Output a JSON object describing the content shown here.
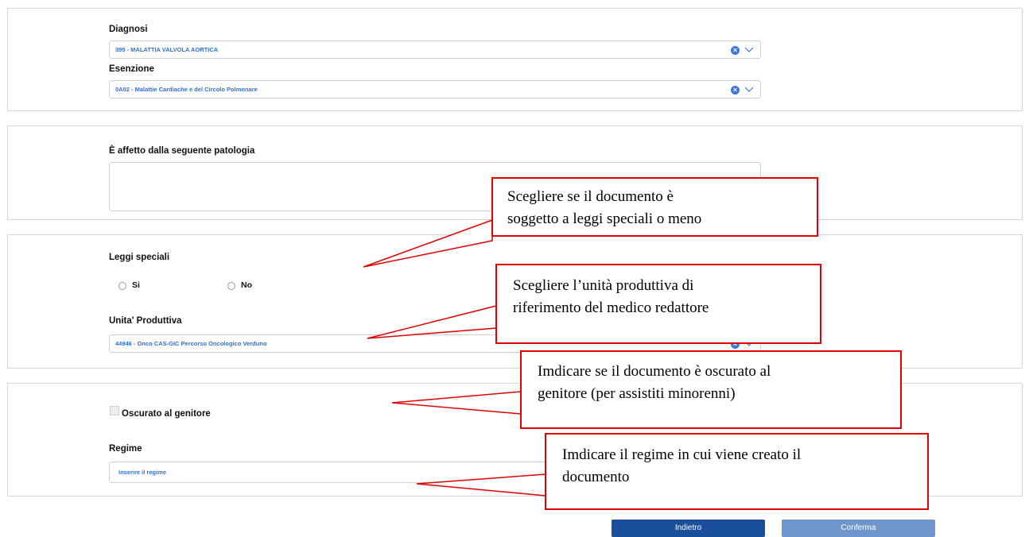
{
  "diagnosis_section": {
    "diagnosi_label": "Diagnosi",
    "diagnosi_value": "395 - MALATTIA VALVOLA AORTICA",
    "esenzione_label": "Esenzione",
    "esenzione_value": "0A02 - Malattie Cardiache e del Circolo Polmonare"
  },
  "patologia_section": {
    "label": "È affetto dalla seguente patologia",
    "value": ""
  },
  "leggi_section": {
    "label": "Leggi speciali",
    "option_si": "Si",
    "option_no": "No",
    "unita_label": "Unita' Produttiva",
    "unita_value": "44946 - Onco CAS-GIC Percorso Oncologico Verduno"
  },
  "oscurato_section": {
    "oscurato_label": "Oscurato al genitore",
    "oscurato_checked": false,
    "regime_label": "Regime",
    "regime_placeholder": "Inserire il regime"
  },
  "buttons": {
    "back": "Indietro",
    "confirm": "Conferma"
  },
  "colors": {
    "back_button": "#1a4f9c",
    "confirm_button": "#6f96cc",
    "link_text": "#2f6fd6",
    "callout_border": "#e20000"
  },
  "annotations": [
    {
      "line1": "Scegliere se il documento è",
      "line2": "soggetto a leggi speciali o meno"
    },
    {
      "line1": "Scegliere l’unità produttiva di",
      "line2": "riferimento del medico redattore"
    },
    {
      "line1": "Imdicare se il documento è oscurato al",
      "line2": "genitore (per assistiti minorenni)"
    },
    {
      "line1": "Imdicare il regime in cui viene creato il",
      "line2": "documento"
    }
  ]
}
